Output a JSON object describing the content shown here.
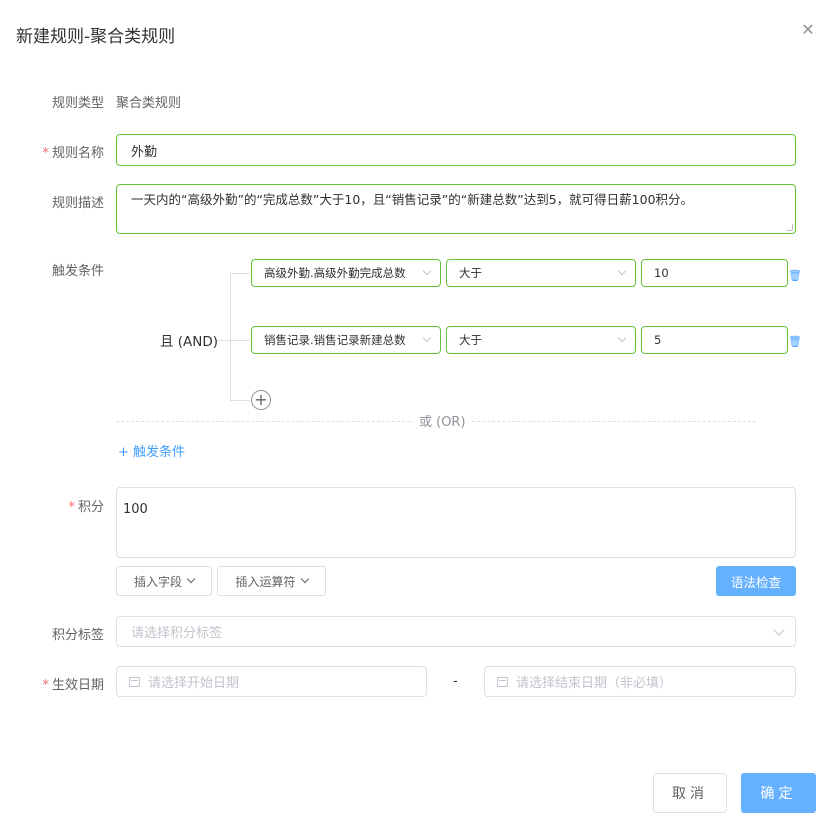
{
  "dialog": {
    "title": "新建规则-聚合类规则",
    "close_icon": "close-icon"
  },
  "form": {
    "rule_type": {
      "label": "规则类型",
      "value": "聚合类规则"
    },
    "rule_name": {
      "label": "规则名称",
      "value": "外勤",
      "required": "*"
    },
    "rule_desc": {
      "label": "规则描述",
      "value": "一天内的“高级外勤”的“完成总数”大于10，且“销售记录”的“新建总数”达到5，就可得日薪100积分。"
    },
    "trigger": {
      "label": "触发条件",
      "group_logic": "且 (AND)",
      "conditions": [
        {
          "field": "高级外勤.高级外勤完成总数",
          "operator": "大于",
          "value": "10"
        },
        {
          "field": "销售记录.销售记录新建总数",
          "operator": "大于",
          "value": "5"
        }
      ],
      "or_label": "或 (OR)",
      "add_label": "+ 触发条件",
      "add_circle": "+"
    },
    "points": {
      "label": "积分",
      "required": "*",
      "value": "100",
      "insert_field_label": "插入字段",
      "insert_operator_label": "插入运算符",
      "syntax_check_label": "语法检查"
    },
    "points_tag": {
      "label": "积分标签",
      "placeholder": "请选择积分标签"
    },
    "effective_date": {
      "label": "生效日期",
      "required": "*",
      "start_placeholder": "请选择开始日期",
      "separator": "-",
      "end_placeholder": "请选择结束日期（非必填）"
    }
  },
  "footer": {
    "cancel_label": "取消",
    "confirm_label": "确定"
  },
  "colors": {
    "accent": "#409eff",
    "valid_border": "#67c23a",
    "required": "#f56c6c",
    "primary_button": "#66b1ff"
  }
}
